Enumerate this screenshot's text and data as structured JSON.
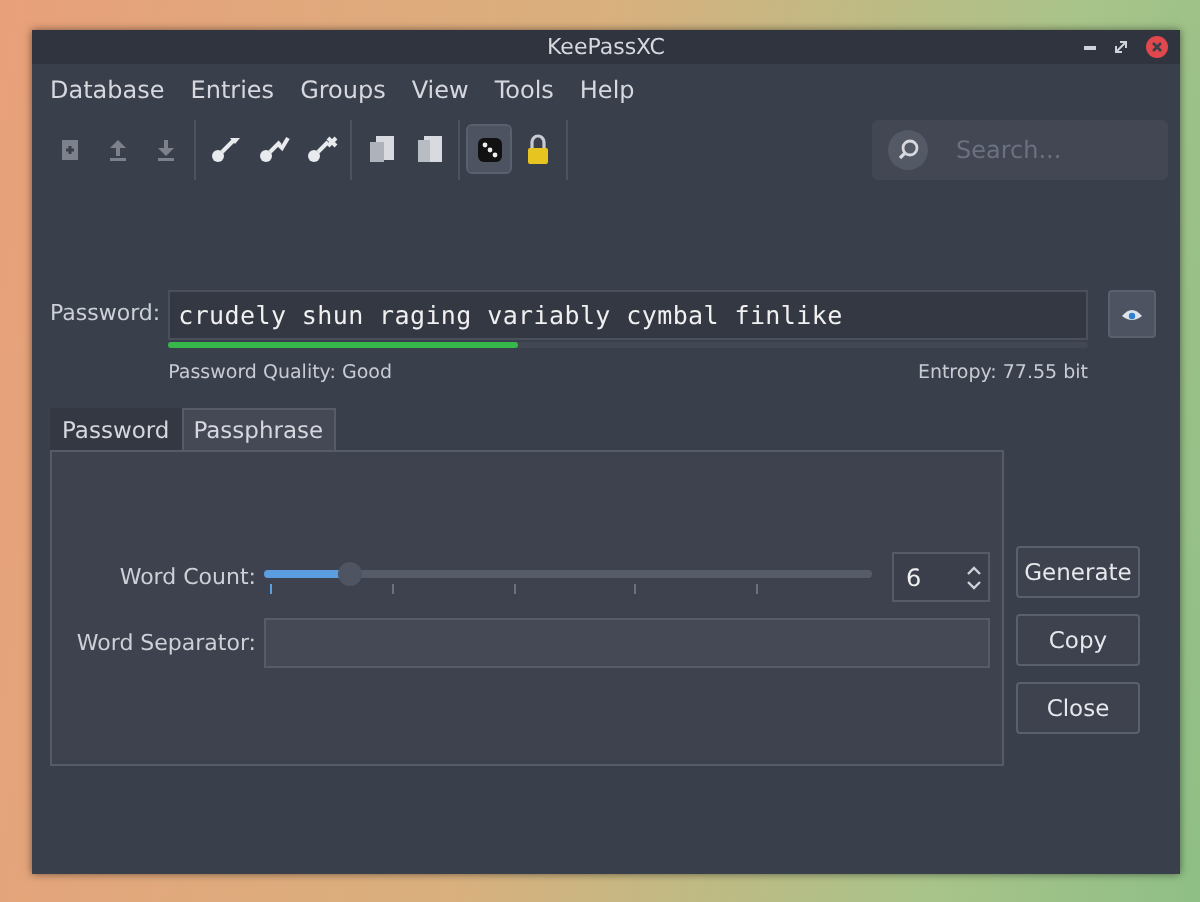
{
  "window": {
    "title": "KeePassXC"
  },
  "menu": [
    "Database",
    "Entries",
    "Groups",
    "View",
    "Tools",
    "Help"
  ],
  "toolbar": [
    [
      {
        "disabled": true,
        "active": false
      },
      {
        "disabled": true,
        "active": false
      },
      {
        "disabled": true,
        "active": false
      }
    ],
    [
      {
        "disabled": false,
        "active": false
      },
      {
        "disabled": false,
        "active": false
      },
      {
        "disabled": false,
        "active": false
      }
    ],
    [
      {
        "disabled": false,
        "active": false
      },
      {
        "disabled": false,
        "active": false
      }
    ],
    [
      {
        "disabled": false,
        "active": true
      },
      {
        "disabled": false,
        "active": false
      }
    ]
  ],
  "search": {
    "placeholder": "Search..."
  },
  "password": {
    "label": "Password:",
    "value": "crudely shun raging variably cymbal finlike",
    "level": 0.38,
    "quality": "Password Quality: Good",
    "entropy": "Entropy: 77.55 bit"
  },
  "tabs": [
    {
      "label": "Password",
      "selected": false
    },
    {
      "label": "Passphrase",
      "selected": true
    }
  ],
  "word_count": {
    "label": "Word Count:",
    "level": 0.14,
    "value": "6"
  },
  "word_separator": {
    "label": "Word Separator:"
  },
  "buttons": [
    "Generate",
    "Copy",
    "Close"
  ]
}
